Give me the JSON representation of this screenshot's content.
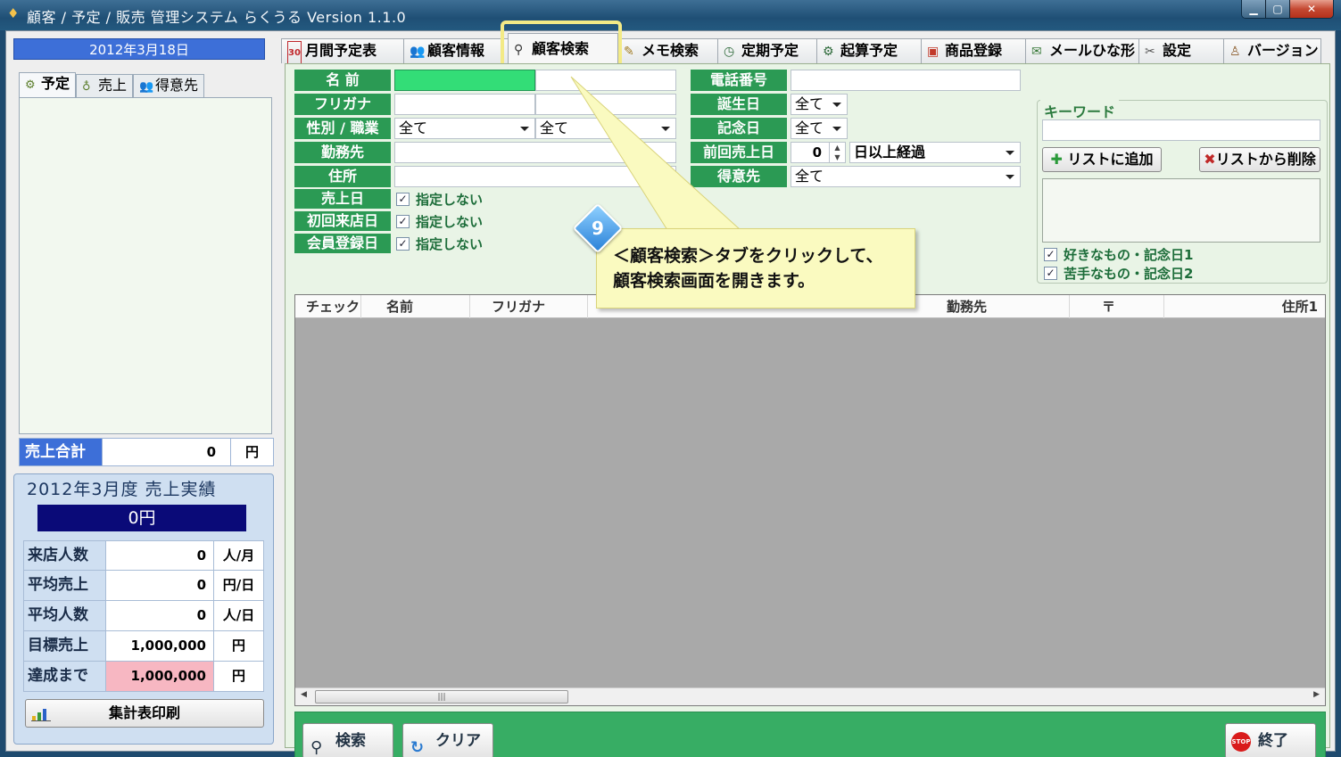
{
  "window": {
    "title": "顧客 / 予定 / 販売 管理システム らくうる  Version 1.1.0",
    "min": "▁",
    "max": "▢",
    "close": "✕"
  },
  "left": {
    "date": "2012年3月18日",
    "tabs": [
      {
        "label": "予定",
        "icon": "gear-icon"
      },
      {
        "label": "売上",
        "icon": "money-bag-icon"
      },
      {
        "label": "得意先",
        "icon": "people-icon"
      }
    ],
    "sales_total": {
      "label": "売上合計",
      "value": "0",
      "unit": "円"
    },
    "results": {
      "title": "2012年3月度 売上実績",
      "amount": "0円",
      "rows": [
        {
          "label": "来店人数",
          "value": "0",
          "unit": "人/月"
        },
        {
          "label": "平均売上",
          "value": "0",
          "unit": "円/日"
        },
        {
          "label": "平均人数",
          "value": "0",
          "unit": "人/日"
        },
        {
          "label": "目標売上",
          "value": "1,000,000",
          "unit": "円"
        },
        {
          "label": "達成まで",
          "value": "1,000,000",
          "unit": "円"
        }
      ],
      "print_label": "集計表印刷"
    }
  },
  "tabs": [
    {
      "label": "月間予定表",
      "icon": "calendar-icon",
      "glyph": "30"
    },
    {
      "label": "顧客情報",
      "icon": "people-icon",
      "glyph": "👥"
    },
    {
      "label": "顧客検索",
      "icon": "search-icon",
      "glyph": "⚲"
    },
    {
      "label": "メモ検索",
      "icon": "memo-icon",
      "glyph": "✎"
    },
    {
      "label": "定期予定",
      "icon": "clock-icon",
      "glyph": "◷"
    },
    {
      "label": "起算予定",
      "icon": "gear-icon",
      "glyph": "⚙"
    },
    {
      "label": "商品登録",
      "icon": "gift-icon",
      "glyph": "▣"
    },
    {
      "label": "メールひな形",
      "icon": "mail-icon",
      "glyph": "✉"
    },
    {
      "label": "設定",
      "icon": "tools-icon",
      "glyph": "✂"
    },
    {
      "label": "バージョン",
      "icon": "person-icon",
      "glyph": "♙"
    }
  ],
  "form": {
    "name_label": "名 前",
    "furigana_label": "フリガナ",
    "gender_job_label": "性別 / 職業",
    "gender_value": "全て",
    "job_value": "全て",
    "workplace_label": "勤務先",
    "address_label": "住所",
    "sale_date_label": "売上日",
    "first_visit_label": "初回来店日",
    "member_reg_label": "会員登録日",
    "not_specified": "指定しない",
    "phone_label": "電話番号",
    "birthday_label": "誕生日",
    "birthday_value": "全て",
    "anniversary_label": "記念日",
    "anniversary_value": "全て",
    "last_sale_label": "前回売上日",
    "last_sale_days": "0",
    "last_sale_unit": "日以上経過",
    "customer_label": "得意先",
    "customer_value": "全て"
  },
  "keyword": {
    "title": "キーワード",
    "add_label": "リストに追加",
    "remove_label": "リストから削除",
    "check1": "好きなもの・記念日1",
    "check2": "苦手なもの・記念日2"
  },
  "grid": {
    "columns": [
      "チェック",
      "名前",
      "フリガナ",
      "勤務先",
      "〒",
      "住所1"
    ]
  },
  "footer": {
    "search_label": "検索",
    "clear_label": "クリア",
    "exit_label": "終了",
    "stop_text": "STOP"
  },
  "callout": {
    "step": "9",
    "line1": "＜顧客検索＞タブをクリックして、",
    "line2": "顧客検索画面を開きます。"
  }
}
